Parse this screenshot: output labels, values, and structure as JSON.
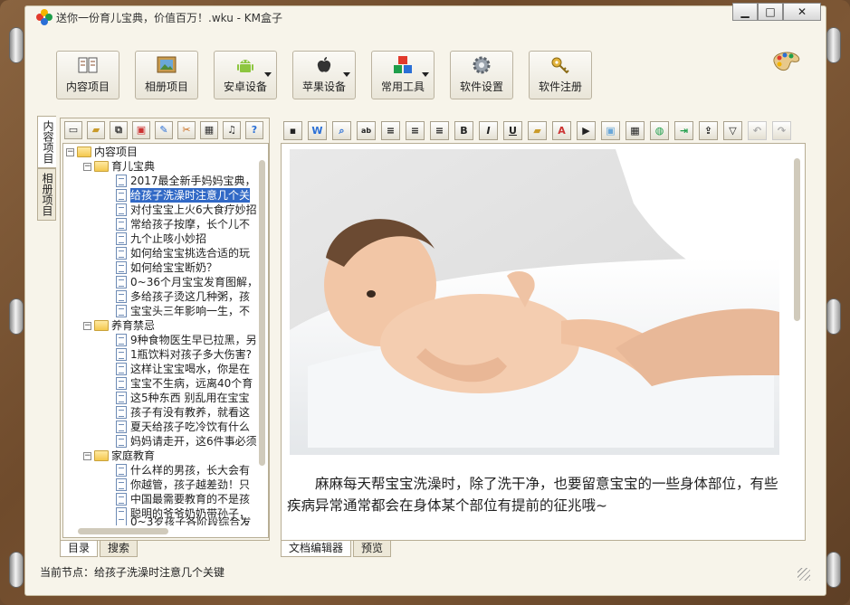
{
  "window": {
    "title": "送你一份育儿宝典，价值百万！.wku - KM盒子",
    "minimize_label": "▁",
    "maximize_label": "□",
    "close_label": "✕"
  },
  "toolbar": {
    "buttons": [
      {
        "label": "内容项目",
        "icon": "book-icon"
      },
      {
        "label": "相册项目",
        "icon": "picture-icon"
      },
      {
        "label": "安卓设备",
        "icon": "android-icon",
        "dropdown": true
      },
      {
        "label": "苹果设备",
        "icon": "apple-icon",
        "dropdown": true
      },
      {
        "label": "常用工具",
        "icon": "tools-icon",
        "dropdown": true
      },
      {
        "label": "软件设置",
        "icon": "gear-icon"
      },
      {
        "label": "软件注册",
        "icon": "key-icon"
      }
    ]
  },
  "side_tabs": {
    "content": "内容项目",
    "album": "相册项目"
  },
  "tree": {
    "root": "内容项目",
    "groups": [
      {
        "name": "育儿宝典",
        "items": [
          "2017最全新手妈妈宝典，",
          "给孩子洗澡时注意几个关",
          "对付宝宝上火6大食疗妙招",
          "常给孩子按摩，长个儿不",
          "九个止咳小妙招",
          "如何给宝宝挑选合适的玩",
          "如何给宝宝断奶？",
          "0~36个月宝宝发育图解，",
          "多给孩子烫这几种粥，孩",
          "宝宝头三年影响一生，不"
        ]
      },
      {
        "name": "养育禁忌",
        "items": [
          "9种食物医生早已拉黑，另",
          "1瓶饮料对孩子多大伤害?",
          "这样让宝宝喝水，你是在",
          "宝宝不生病，远离40个育",
          "这5种东西 别乱用在宝宝",
          "孩子有没有教养，就看这",
          "夏天给孩子吃冷饮有什么",
          "妈妈请走开，这6件事必须"
        ]
      },
      {
        "name": "家庭教育",
        "items": [
          "什么样的男孩，长大会有",
          "你越管，孩子越差劲！只",
          "中国最需要教育的不是孩",
          "聪明的爷爷奶奶带孙子，",
          "0~3岁孩子各阶段综合发"
        ]
      }
    ],
    "selected": "给孩子洗澡时注意几个关"
  },
  "left_bottom_tabs": [
    "目录",
    "搜索"
  ],
  "editor_bottom_tabs": [
    "文档编辑器",
    "预览"
  ],
  "editor": {
    "article_text": "麻麻每天帮宝宝洗澡时，除了洗干净，也要留意宝宝的一些身体部位，有些疾病异常通常都会在身体某个部位有提前的征兆哦~"
  },
  "status": {
    "text": "当前节点：给孩子洗澡时注意几个关键"
  }
}
